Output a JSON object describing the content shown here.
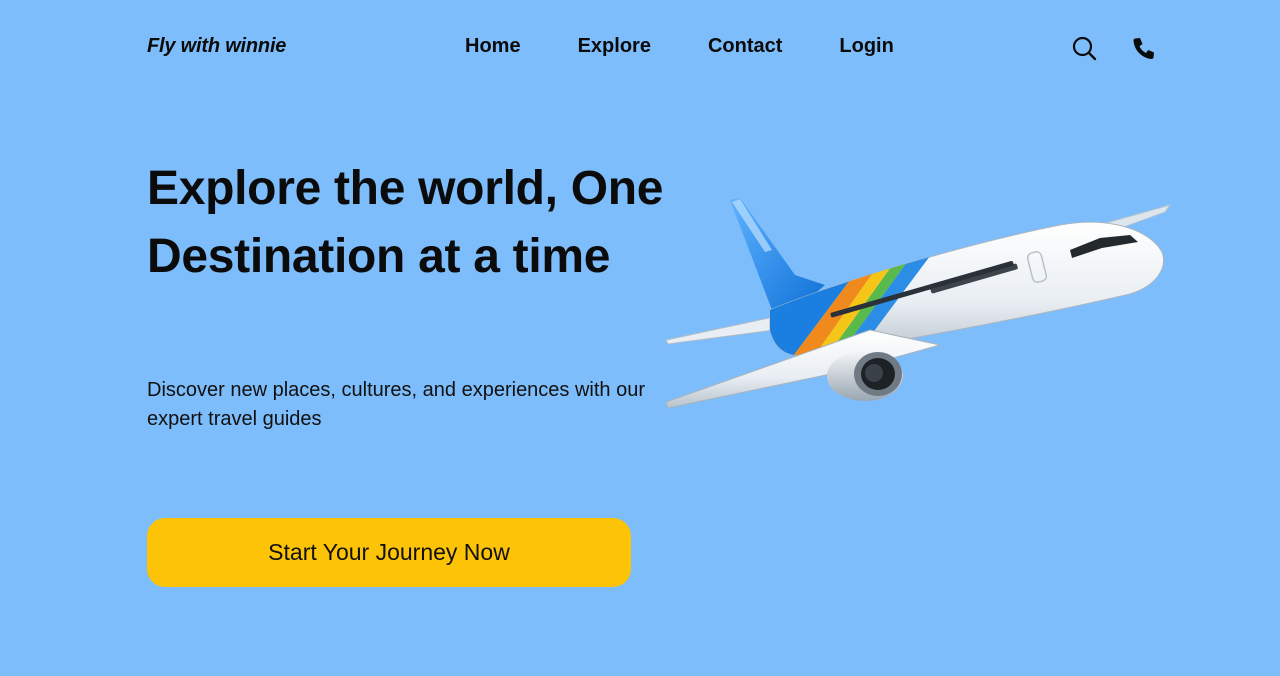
{
  "nav": {
    "brand": "Fly with winnie",
    "links": [
      "Home",
      "Explore",
      "Contact",
      "Login"
    ],
    "icons": [
      "search-icon",
      "phone-icon"
    ]
  },
  "hero": {
    "title": "Explore the world, One Destination at a time",
    "subtitle": "Discover new places, cultures, and experiences with our expert travel guides",
    "cta_label": "Start Your Journey Now"
  },
  "colors": {
    "background": "#7dbdfb",
    "cta": "#fdc306",
    "text": "#0b0b0b"
  }
}
